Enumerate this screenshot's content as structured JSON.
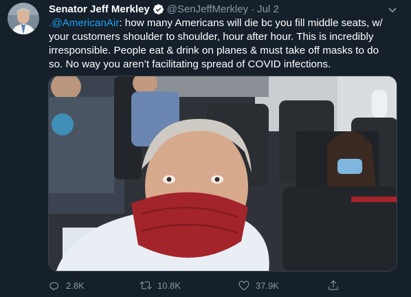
{
  "tweet": {
    "author_name": "Senator Jeff Merkley",
    "handle": "@SenJeffMerkley",
    "separator": "·",
    "date": "Jul 2",
    "lines": {
      "l1_mention": ".@AmericanAir",
      "l1_rest": ": how many Americans will die bc you fill middle seats, w/",
      "l2": "your customers shoulder to shoulder, hour after hour. This is incredibly",
      "l3": "irresponsible. People eat & drink on planes & must take off masks to do",
      "l4": "so. No way you aren’t facilitating spread of COVID infections."
    }
  },
  "actions": {
    "reply": {
      "icon": "reply-icon",
      "count": "2.8K"
    },
    "retweet": {
      "icon": "retweet-icon",
      "count": "10.8K"
    },
    "like": {
      "icon": "heart-icon",
      "count": "37.9K"
    },
    "share": {
      "icon": "share-icon"
    }
  },
  "colors": {
    "background": "#15202b",
    "text": "#ffffff",
    "muted": "#8899a6",
    "link": "#1da1f2",
    "mask": "#a3242b"
  }
}
